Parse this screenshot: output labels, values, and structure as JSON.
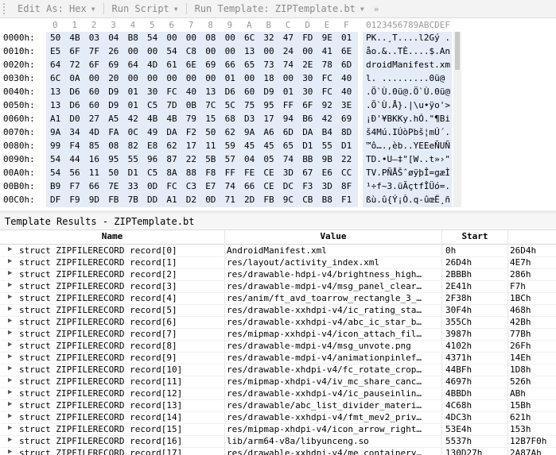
{
  "toolbar": {
    "items": [
      {
        "label": "Edit As: Hex",
        "icon": "dropdown-arrow"
      },
      {
        "label": "Run Script",
        "icon": "dropdown-arrow"
      },
      {
        "label": "Run Template: ZIPTemplate.bt",
        "icon": "dropdown-arrow"
      }
    ],
    "more": "»"
  },
  "hex": {
    "ruler": [
      "0",
      "1",
      "2",
      "3",
      "4",
      "5",
      "6",
      "7",
      "8",
      "9",
      "A",
      "B",
      "C",
      "D",
      "E",
      "F"
    ],
    "ascii_ruler": "0123456789ABCDEF",
    "rows": [
      {
        "addr": "0000h:",
        "bytes": [
          "50",
          "4B",
          "03",
          "04",
          "B8",
          "54",
          "00",
          "00",
          "08",
          "00",
          "6C",
          "32",
          "47",
          "FD",
          "9E",
          "01"
        ],
        "ascii": "PK..¸T....l2Gý ."
      },
      {
        "addr": "0010h:",
        "bytes": [
          "E5",
          "6F",
          "7F",
          "26",
          "00",
          "00",
          "54",
          "C8",
          "00",
          "00",
          "13",
          "00",
          "24",
          "00",
          "41",
          "6E"
        ],
        "ascii": "åo.&..TÈ....$.An"
      },
      {
        "addr": "0020h:",
        "bytes": [
          "64",
          "72",
          "6F",
          "69",
          "64",
          "4D",
          "61",
          "6E",
          "69",
          "66",
          "65",
          "73",
          "74",
          "2E",
          "78",
          "6D"
        ],
        "ascii": "droidManifest.xm"
      },
      {
        "addr": "0030h:",
        "bytes": [
          "6C",
          "0A",
          "00",
          "20",
          "00",
          "00",
          "00",
          "00",
          "00",
          "01",
          "00",
          "18",
          "00",
          "30",
          "FC",
          "40"
        ],
        "ascii": "l. .........0ü@"
      },
      {
        "addr": "0040h:",
        "bytes": [
          "13",
          "D6",
          "60",
          "D9",
          "01",
          "30",
          "FC",
          "40",
          "13",
          "D6",
          "60",
          "D9",
          "01",
          "30",
          "FC",
          "40"
        ],
        "ascii": ".Ö`Ù.0ü@.Ö`Ù.0ü@"
      },
      {
        "addr": "0050h:",
        "bytes": [
          "13",
          "D6",
          "60",
          "D9",
          "01",
          "C5",
          "7D",
          "0B",
          "7C",
          "5C",
          "75",
          "95",
          "FF",
          "6F",
          "92",
          "3E"
        ],
        "ascii": ".Ö`Ù.Å}.|\\u•ÿo'>"
      },
      {
        "addr": "0060h:",
        "bytes": [
          "A1",
          "D0",
          "27",
          "A5",
          "42",
          "4B",
          "4B",
          "79",
          "15",
          "68",
          "D3",
          "17",
          "94",
          "B6",
          "42",
          "69"
        ],
        "ascii": "¡Ð'¥BKKy.hÓ.\"¶Bi"
      },
      {
        "addr": "0070h:",
        "bytes": [
          "9A",
          "34",
          "4D",
          "FA",
          "0C",
          "49",
          "DA",
          "F2",
          "50",
          "62",
          "9A",
          "A6",
          "6D",
          "DA",
          "B4",
          "8D"
        ],
        "ascii": "š4Mú.IÚòPbš¦mÚ´."
      },
      {
        "addr": "0080h:",
        "bytes": [
          "99",
          "F4",
          "85",
          "08",
          "82",
          "E8",
          "62",
          "17",
          "11",
          "59",
          "45",
          "45",
          "65",
          "D1",
          "55",
          "D1"
        ],
        "ascii": "™ô….‚èb..YEEeÑUÑ"
      },
      {
        "addr": "0090h:",
        "bytes": [
          "54",
          "44",
          "16",
          "95",
          "55",
          "96",
          "87",
          "22",
          "5B",
          "57",
          "04",
          "05",
          "74",
          "BB",
          "9B",
          "22"
        ],
        "ascii": "TD.•U–‡\"[W..t»›\""
      },
      {
        "addr": "00A0h:",
        "bytes": [
          "54",
          "56",
          "11",
          "50",
          "D1",
          "C5",
          "8A",
          "88",
          "F8",
          "FF",
          "FE",
          "CE",
          "3D",
          "67",
          "E6",
          "CC"
        ],
        "ascii": "TV.PÑÅŠˆøÿþÎ=gæÌ"
      },
      {
        "addr": "00B0h:",
        "bytes": [
          "B9",
          "F7",
          "66",
          "7E",
          "33",
          "0D",
          "FC",
          "C3",
          "E7",
          "74",
          "66",
          "CE",
          "DC",
          "F3",
          "3D",
          "8F"
        ],
        "ascii": "¹÷f~3.üÃçtfÎÜó=."
      },
      {
        "addr": "00C0h:",
        "bytes": [
          "DF",
          "F9",
          "9D",
          "FB",
          "7B",
          "DD",
          "A1",
          "D2",
          "0D",
          "71",
          "2D",
          "FB",
          "9C",
          "CB",
          "B8",
          "F1"
        ],
        "ascii": "ßù.û{Ý¡Ò.q-ûœË¸ñ"
      }
    ]
  },
  "template": {
    "title": "Template Results - ZIPTemplate.bt",
    "columns": [
      "Name",
      "Value",
      "Start",
      ""
    ],
    "rows": [
      {
        "name": "struct ZIPFILERECORD record[0]",
        "value": "AndroidManifest.xml",
        "start": "0h",
        "size": "26D4h"
      },
      {
        "name": "struct ZIPFILERECORD record[1]",
        "value": "res/layout/activity_index.xml",
        "start": "26D4h",
        "size": "4E7h"
      },
      {
        "name": "struct ZIPFILERECORD record[2]",
        "value": "res/drawable-hdpi-v4/brightness_high…",
        "start": "2BBBh",
        "size": "286h"
      },
      {
        "name": "struct ZIPFILERECORD record[3]",
        "value": "res/drawable-mdpi-v4/msg_panel_clear…",
        "start": "2E41h",
        "size": "F7h"
      },
      {
        "name": "struct ZIPFILERECORD record[4]",
        "value": "res/anim/ft_avd_toarrow_rectangle_3_…",
        "start": "2F38h",
        "size": "1BCh"
      },
      {
        "name": "struct ZIPFILERECORD record[5]",
        "value": "res/drawable-xxhdpi-v4/ic_rating_sta…",
        "start": "30F4h",
        "size": "468h"
      },
      {
        "name": "struct ZIPFILERECORD record[6]",
        "value": "res/drawable-xxhdpi-v4/abc_ic_star_b…",
        "start": "355Ch",
        "size": "42Bh"
      },
      {
        "name": "struct ZIPFILERECORD record[7]",
        "value": "res/mipmap-xxhdpi-v4/icon_attach_fil…",
        "start": "3987h",
        "size": "77Bh"
      },
      {
        "name": "struct ZIPFILERECORD record[8]",
        "value": "res/drawable-mdpi-v4/msg_unvote.png",
        "start": "4102h",
        "size": "26Fh"
      },
      {
        "name": "struct ZIPFILERECORD record[9]",
        "value": "res/drawable-mdpi-v4/animationpinlef…",
        "start": "4371h",
        "size": "14Eh"
      },
      {
        "name": "struct ZIPFILERECORD record[10]",
        "value": "res/drawable-xhdpi-v4/fc_rotate_crop…",
        "start": "44BFh",
        "size": "1D8h"
      },
      {
        "name": "struct ZIPFILERECORD record[11]",
        "value": "res/mipmap-xhdpi-v4/iv_mc_share_canc…",
        "start": "4697h",
        "size": "526h"
      },
      {
        "name": "struct ZIPFILERECORD record[12]",
        "value": "res/drawable-xxhdpi-v4/ic_pauseinlin…",
        "start": "4BBDh",
        "size": "ABh"
      },
      {
        "name": "struct ZIPFILERECORD record[13]",
        "value": "res/drawable/abc_list_divider_materi…",
        "start": "4C68h",
        "size": "15Bh"
      },
      {
        "name": "struct ZIPFILERECORD record[14]",
        "value": "res/drawable-xxhdpi-v4/fmt_mev2_priv…",
        "start": "4DC3h",
        "size": "621h"
      },
      {
        "name": "struct ZIPFILERECORD record[15]",
        "value": "res/mipmap-xhdpi-v4/icon_arrow_right…",
        "start": "53E4h",
        "size": "153h"
      },
      {
        "name": "struct ZIPFILERECORD record[16]",
        "value": "lib/arm64-v8a/libyunceng.so",
        "start": "5537h",
        "size": "12B7F0h"
      },
      {
        "name": "struct ZIPFILERECORD record[17]",
        "value": "res/drawable-xxhdpi-v4/me_containery…",
        "start": "130D27h",
        "size": "2A87Ah"
      }
    ]
  }
}
